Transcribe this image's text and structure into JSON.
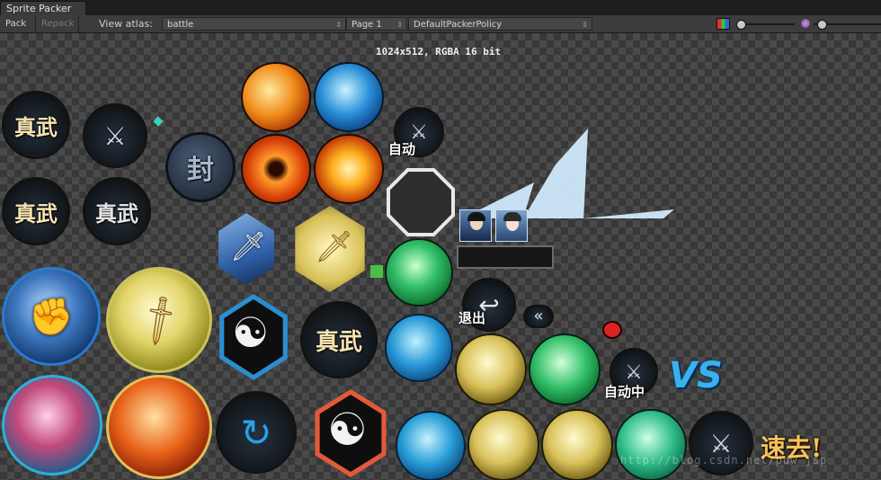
{
  "window": {
    "tab_title": "Sprite Packer"
  },
  "toolbar": {
    "pack_label": "Pack",
    "repack_label": "Repack",
    "view_atlas_label": "View atlas:",
    "atlas_value": "battle",
    "page_value": "Page 1",
    "policy_value": "DefaultPackerPolicy"
  },
  "canvas": {
    "size_label": "1024x512, RGBA 16 bit"
  },
  "sprites": {
    "zhenwu": "真武",
    "feng": "封",
    "zidong": "自动",
    "tuichu": "退出",
    "zidongzhong": "自动中",
    "vs": "VS",
    "suqu": "速去!",
    "chevron": "«"
  },
  "watermark": "http://blog.csdn.net/pdw_jsp",
  "colors": {
    "accent_blue": "#2a8fd8",
    "accent_gold": "#d9c25a",
    "accent_green": "#33c06a"
  }
}
